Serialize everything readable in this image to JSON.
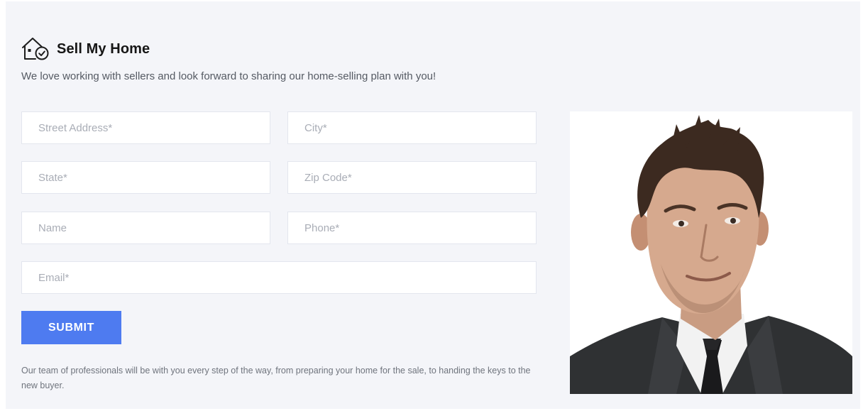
{
  "header": {
    "title": "Sell My Home",
    "subtitle": "We love working with sellers and look forward to sharing our home-selling plan with you!",
    "icon": "house-check-icon"
  },
  "form": {
    "street_placeholder": "Street Address*",
    "city_placeholder": "City*",
    "state_placeholder": "State*",
    "zip_placeholder": "Zip Code*",
    "name_placeholder": "Name",
    "phone_placeholder": "Phone*",
    "email_placeholder": "Email*",
    "street_value": "",
    "city_value": "",
    "state_value": "",
    "zip_value": "",
    "name_value": "",
    "phone_value": "",
    "email_value": "",
    "submit_label": "SUBMIT"
  },
  "footnote": "Our team of professionals will be with you every step of the way, from preparing your home for the sale, to handing the keys to the new buyer.",
  "colors": {
    "background": "#f4f5f9",
    "accent": "#4e7bf0",
    "field_border": "#e3e6ee",
    "title": "#161616"
  }
}
